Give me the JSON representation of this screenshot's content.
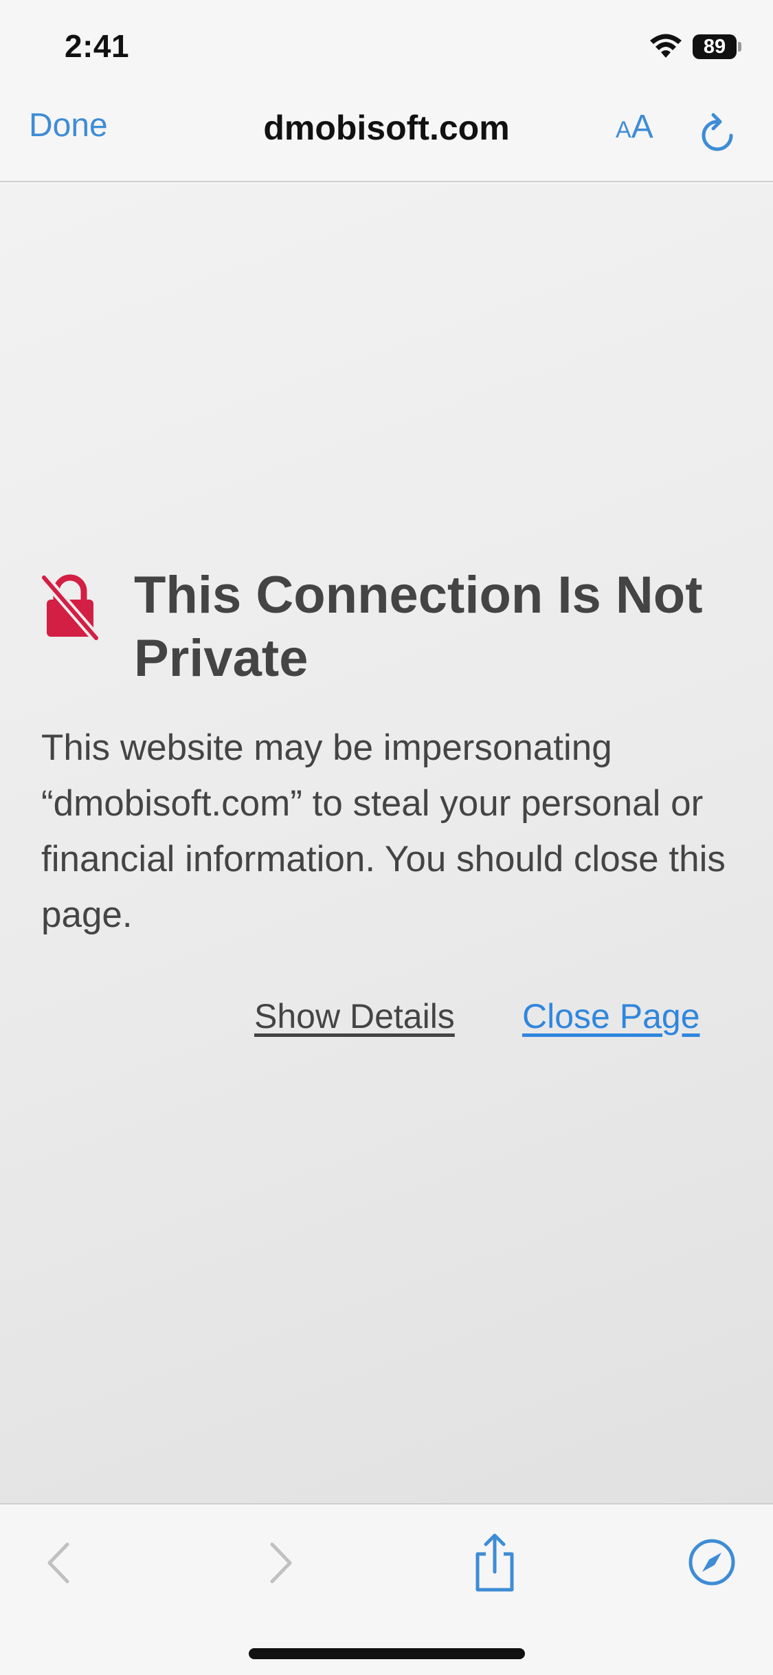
{
  "status_bar": {
    "time": "2:41",
    "battery": "89",
    "icons": [
      "wifi-icon",
      "battery-icon"
    ]
  },
  "nav": {
    "done_label": "Done",
    "title": "dmobisoft.com",
    "text_size_label_small": "A",
    "text_size_label_big": "A",
    "icons": [
      "reload-icon"
    ]
  },
  "warning": {
    "icon": "lock-slash-icon",
    "icon_color": "#d21f43",
    "title": "This Connection Is Not Private",
    "message": "This website may be impersonating “dmobisoft.com” to steal your personal or financial information. You should close this page.",
    "show_details_label": "Show Details",
    "close_page_label": "Close Page"
  },
  "toolbar": {
    "icons": [
      "back-icon",
      "forward-icon",
      "share-icon",
      "compass-icon"
    ]
  },
  "colors": {
    "accent": "#3e8cd6",
    "link": "#2f86dd",
    "text": "#444444",
    "disabled": "#c0c0c0"
  }
}
